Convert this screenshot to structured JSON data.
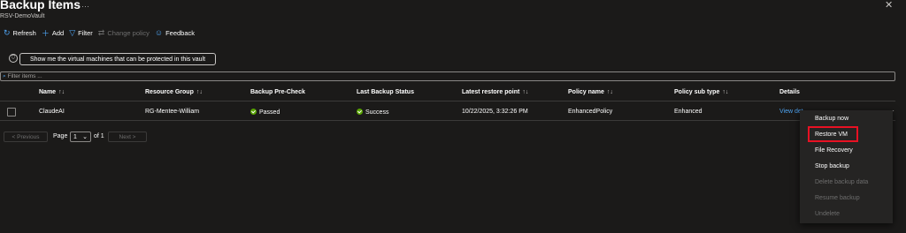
{
  "header": {
    "title": "Backup Items",
    "more": "···",
    "subtitle": "RSV-DemoVault",
    "close": "✕"
  },
  "toolbar": {
    "refresh": "Refresh",
    "add": "Add",
    "filter": "Filter",
    "change_policy": "Change policy",
    "feedback": "Feedback"
  },
  "protect_button": "Show me the virtual machines that can be protected in this vault",
  "filter_input": {
    "placeholder": "Filter items ..."
  },
  "table": {
    "columns": [
      "Name",
      "Resource Group",
      "Backup Pre-Check",
      "Last Backup Status",
      "Latest restore point",
      "Policy name",
      "Policy sub type",
      "Details"
    ],
    "sort_glyph": "↑↓",
    "rows": [
      {
        "name": "ClaudeAI",
        "resource_group": "RG-Mentee-William",
        "pre_check": "Passed",
        "last_status": "Success",
        "restore_point": "10/22/2025, 3:32:26 PM",
        "policy_name": "EnhancedPolicy",
        "policy_sub_type": "Enhanced",
        "details": "View det"
      }
    ]
  },
  "pager": {
    "previous": "< Previous",
    "page_label": "Page",
    "page_value": "1",
    "of_label": "of 1",
    "next": "Next >"
  },
  "context_menu": {
    "items": [
      {
        "label": "Backup now",
        "enabled": true
      },
      {
        "label": "Restore VM",
        "enabled": true
      },
      {
        "label": "File Recovery",
        "enabled": true
      },
      {
        "label": "Stop backup",
        "enabled": true
      },
      {
        "label": "Delete backup data",
        "enabled": false
      },
      {
        "label": "Resume backup",
        "enabled": false
      },
      {
        "label": "Undelete",
        "enabled": false
      }
    ]
  },
  "colors": {
    "accent": "#4ea3f1",
    "success": "#57a300",
    "highlight": "#e81123",
    "background": "#1b1a19"
  }
}
